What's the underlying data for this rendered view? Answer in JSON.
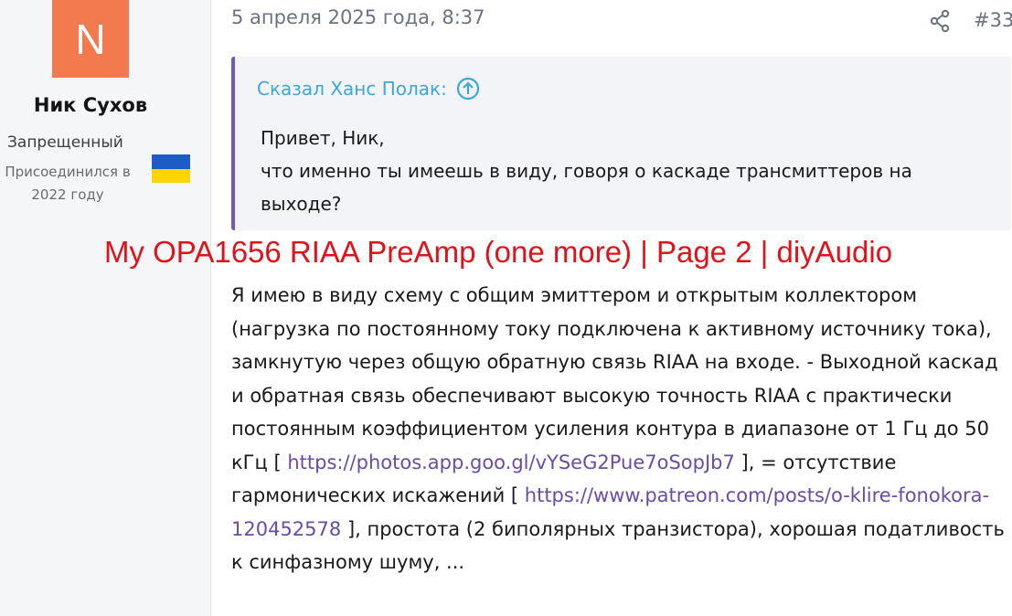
{
  "author": {
    "avatar_letter": "N",
    "avatar_color": "#f27a4e",
    "name": "Ник Сухов",
    "title": "Запрещенный",
    "joined_line1": "Присоединился в",
    "joined_line2": "2022 году",
    "flag_icon": "ukraine-flag"
  },
  "post": {
    "date": "5 апреля 2025 года, 8:37",
    "share_icon": "share-icon",
    "number": "#33"
  },
  "quote": {
    "attribution": "Сказал Ханс Полак:",
    "expand_icon": "arrow-up-circle-icon",
    "line1": "Привет, Ник,",
    "line2": "что именно ты имеешь в виду, говоря о каскаде трансмиттеров на выходе?"
  },
  "overlay_title": "My OPA1656 RIAA PreAmp (one more) | Page 2 | diyAudio",
  "message": {
    "part1": "Я имею в виду схему с общим эмиттером и открытым коллектором (нагрузка по постоянному току подключена к активному источнику тока), замкнутую через общую обратную связь RIAA на входе. - Выходной каскад и обратная связь обеспечивают высокую точность RIAA с практически постоянным коэффициентом усиления контура в диапазоне от 1 Гц до 50 кГц [",
    "link1": "https://photos.app.goo.gl/vYSeG2Pue7oSopJb7",
    "part2": "], = отсутствие гармонических искажений [",
    "link2": "https://www.patreon.com/posts/o-klire-fonokora-120452578",
    "part3": "], простота (2 биполярных транзистора), хорошая податливость к синфазному шуму, ..."
  },
  "colors": {
    "accent_quote_border": "#7557ba",
    "link": "#6a4ca3",
    "quote_attribution": "#3ea6d8",
    "overlay_title": "#e0131b"
  }
}
